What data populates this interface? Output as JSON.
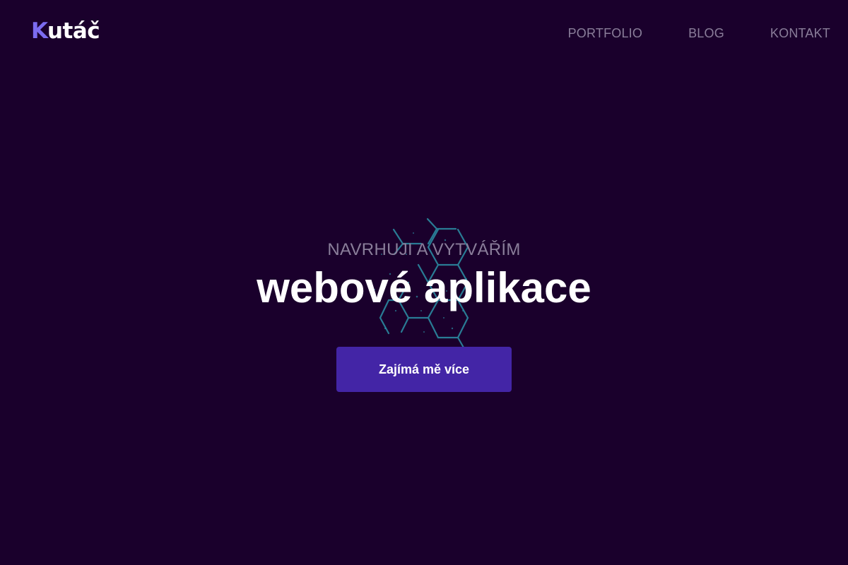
{
  "header": {
    "logo": {
      "accent_letter": "K",
      "rest": "utáč",
      "accent_color": "#7c6cf0"
    },
    "nav": [
      {
        "label": "PORTFOLIO"
      },
      {
        "label": "BLOG"
      },
      {
        "label": "KONTAKT"
      }
    ]
  },
  "hero": {
    "eyebrow": "NAVRHUJI A VYTVÁŘÍM",
    "title": "webové aplikace",
    "cta_label": "Zajímá mě více",
    "background_graphic": "hexagon-network-icon"
  },
  "colors": {
    "background": "#1a002c",
    "nav_text": "#8a7e9a",
    "button": "#4325a6",
    "graphic": "#2fa6b8"
  }
}
